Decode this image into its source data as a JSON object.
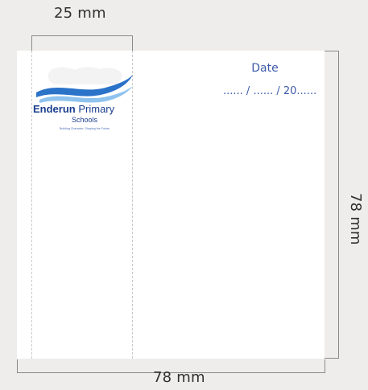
{
  "dimensions": {
    "top_width": "25 mm",
    "right_height": "78 mm",
    "bottom_width": "78 mm"
  },
  "logo": {
    "name_bold": "Enderun",
    "name_regular": " Primary",
    "schools": "Schools",
    "tagline": "Building Character, Shaping the Future",
    "colors": {
      "navy": "#1b3f8f",
      "wave_blue": "#2a73c9",
      "wave_light": "#8fc3ee"
    }
  },
  "date": {
    "label": "Date",
    "placeholder": "...... / ...... / 20......"
  },
  "colors": {
    "background": "#efedeb",
    "paper": "#ffffff",
    "text_blue": "#3e5aa8",
    "dimension_line": "#8a8a8a"
  }
}
